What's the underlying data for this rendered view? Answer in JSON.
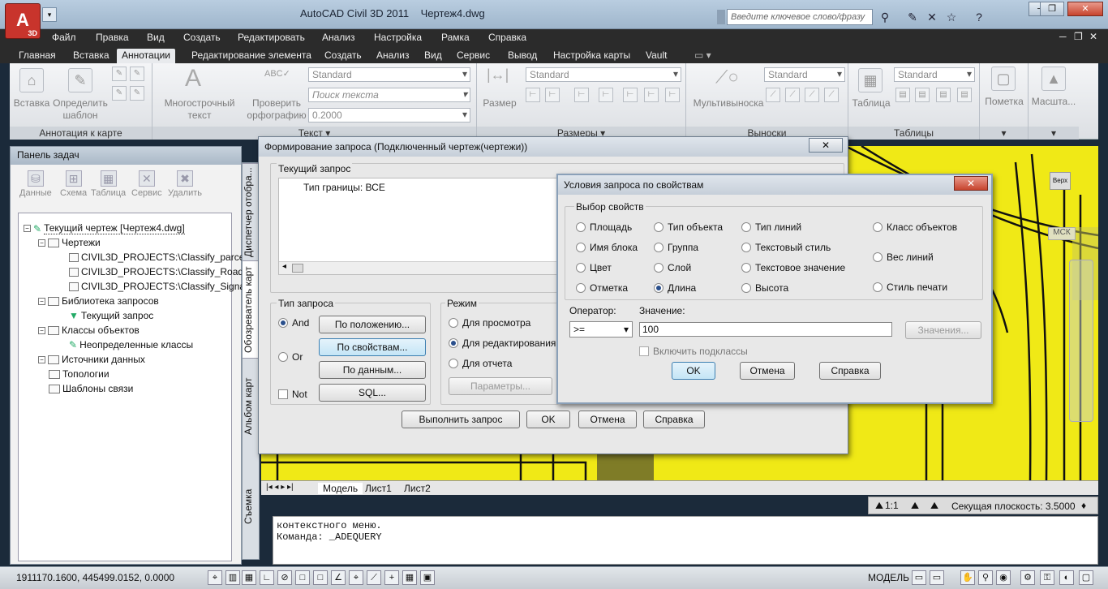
{
  "app": {
    "title": "AutoCAD Civil 3D 2011",
    "document": "Чертеж4.dwg",
    "logo_text": "3D",
    "search_placeholder": "Введите ключевое слово/фразу"
  },
  "menu": [
    "Файл",
    "Правка",
    "Вид",
    "Создать",
    "Редактировать",
    "Анализ",
    "Настройка",
    "Рамка",
    "Справка"
  ],
  "ribbon_tabs": [
    "Главная",
    "Вставка",
    "Аннотации",
    "Редактирование элемента",
    "Создать",
    "Анализ",
    "Вид",
    "Сервис",
    "Вывод",
    "Настройка карты",
    "Vault"
  ],
  "ribbon_active_tab": "Аннотации",
  "ribbon": {
    "annotation_panel": {
      "title": "Аннотация к карте",
      "insert": "Вставка",
      "define": "Определить шаблон"
    },
    "text_panel": {
      "title": "Текст",
      "multiline": "Многострочный текст",
      "spell": "Проверить орфографию",
      "style": "Standard",
      "find_placeholder": "Поиск текста",
      "height": "0.2000"
    },
    "dim_panel": {
      "title": "Размеры",
      "dim": "Размер",
      "style": "Standard"
    },
    "leader_panel": {
      "title": "Выноски",
      "multileader": "Мультивыноска",
      "style": "Standard"
    },
    "table_panel": {
      "title": "Таблицы",
      "table": "Таблица",
      "style": "Standard"
    },
    "mark": "Пометка",
    "scale": "Масшта..."
  },
  "taskpane": {
    "title": "Панель задач",
    "tools": [
      "Данные",
      "Схема",
      "Таблица",
      "Сервис",
      "Удалить"
    ],
    "tree": [
      "Текущий чертеж [Чертеж4.dwg]",
      "Чертежи",
      "CIVIL3D_PROJECTS:\\Classify_parce",
      "CIVIL3D_PROJECTS:\\Classify_Road",
      "CIVIL3D_PROJECTS:\\Classify_Signa",
      "Библиотека запросов",
      "Текущий запрос",
      "Классы объектов",
      "Неопределенные классы",
      "Источники данных",
      "Топологии",
      "Шаблоны связи"
    ],
    "side_tabs": [
      "Диспетчер отобра...",
      "Обозреватель карт",
      "Альбом карт",
      "Съемка"
    ]
  },
  "query_dialog": {
    "title": "Формирование запроса (Подключенный чертеж(чертежи))",
    "current_query_label": "Текущий запрос",
    "current_query_text": "Тип границы: ВСЕ",
    "query_type_label": "Тип запроса",
    "and": "And",
    "or": "Or",
    "not": "Not",
    "by_location": "По положению...",
    "by_property": "По свойствам...",
    "by_data": "По данным...",
    "sql": "SQL...",
    "mode_label": "Режим",
    "mode_view": "Для просмотра",
    "mode_edit": "Для редактирования",
    "mode_report": "Для отчета",
    "params": "Параметры...",
    "execute": "Выполнить запрос",
    "ok": "OK",
    "cancel": "Отмена",
    "help": "Справка"
  },
  "property_dialog": {
    "title": "Условия запроса по свойствам",
    "group_label": "Выбор свойств",
    "props": [
      [
        "Площадь",
        "Тип объекта",
        "Тип линий",
        "Класс объектов"
      ],
      [
        "Имя блока",
        "Группа",
        "Текстовый стиль",
        "Вес линий"
      ],
      [
        "Цвет",
        "Слой",
        "Текстовое значение",
        "Стиль печати"
      ],
      [
        "Отметка",
        "Длина",
        "Высота",
        ""
      ]
    ],
    "selected": "Длина",
    "operator_label": "Оператор:",
    "operator_value": ">=",
    "value_label": "Значение:",
    "value": "100",
    "values_btn": "Значения...",
    "include_subclasses": "Включить подклассы",
    "ok": "OK",
    "cancel": "Отмена",
    "help": "Справка"
  },
  "drawing": {
    "ucs": "МСК",
    "viewcube": "Верх"
  },
  "layout_tabs": [
    "Модель",
    "Лист1",
    "Лист2"
  ],
  "command_lines": [
    "контекстного меню.",
    "Команда:  _ADEQUERY"
  ],
  "status": {
    "coords": "1911170.1600, 445499.0152, 0.0000",
    "model": "МОДЕЛЬ",
    "scale": "1:1",
    "cut_plane": "Секущая плоскость: 3.5000"
  },
  "colors": {
    "drawing_bg": "#f0e916",
    "menu_bg": "#2b2b2b"
  }
}
